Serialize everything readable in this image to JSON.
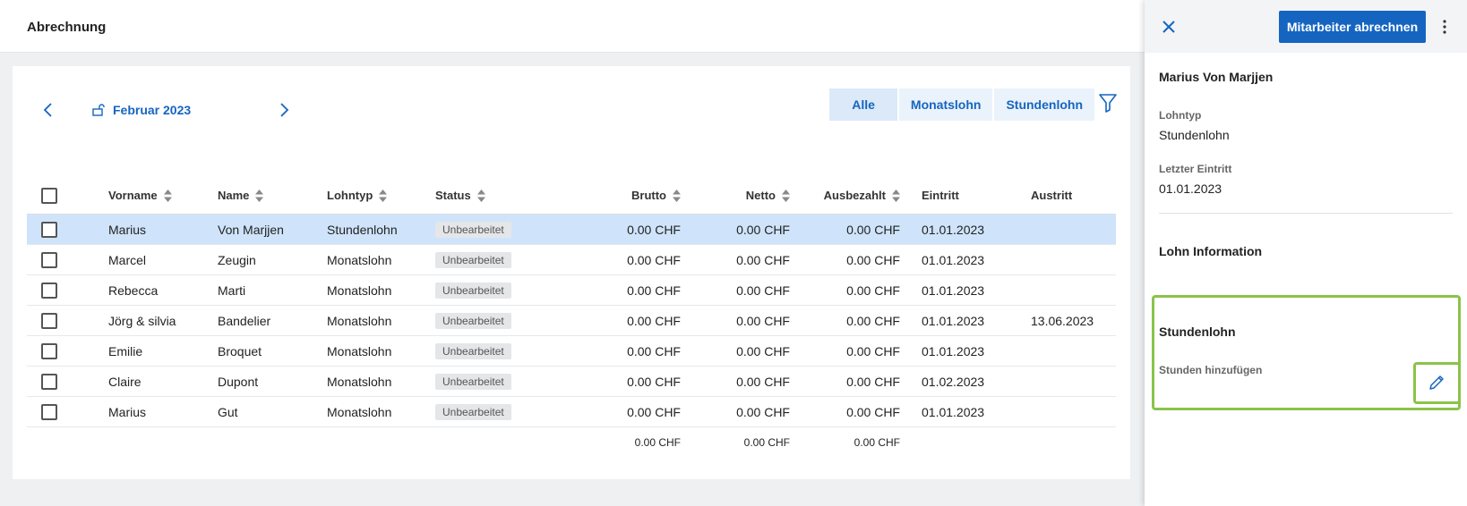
{
  "page": {
    "title": "Abrechnung"
  },
  "month_nav": {
    "label": "Februar 2023"
  },
  "filters": [
    "Alle",
    "Monatslohn",
    "Stundenlohn"
  ],
  "table": {
    "headers": {
      "first": "Vorname",
      "name": "Name",
      "type": "Lohntyp",
      "status": "Status",
      "brutto": "Brutto",
      "netto": "Netto",
      "paid": "Ausbezahlt",
      "entry": "Eintritt",
      "exit": "Austritt"
    },
    "rows": [
      {
        "first": "Marius",
        "name": "Von Marjjen",
        "type": "Stundenlohn",
        "status": "Unbearbeitet",
        "brutto": "0.00 CHF",
        "netto": "0.00 CHF",
        "paid": "0.00 CHF",
        "entry": "01.01.2023",
        "exit": ""
      },
      {
        "first": "Marcel",
        "name": "Zeugin",
        "type": "Monatslohn",
        "status": "Unbearbeitet",
        "brutto": "0.00 CHF",
        "netto": "0.00 CHF",
        "paid": "0.00 CHF",
        "entry": "01.01.2023",
        "exit": ""
      },
      {
        "first": "Rebecca",
        "name": "Marti",
        "type": "Monatslohn",
        "status": "Unbearbeitet",
        "brutto": "0.00 CHF",
        "netto": "0.00 CHF",
        "paid": "0.00 CHF",
        "entry": "01.01.2023",
        "exit": ""
      },
      {
        "first": "Jörg & silvia",
        "name": "Bandelier",
        "type": "Monatslohn",
        "status": "Unbearbeitet",
        "brutto": "0.00 CHF",
        "netto": "0.00 CHF",
        "paid": "0.00 CHF",
        "entry": "01.01.2023",
        "exit": "13.06.2023"
      },
      {
        "first": "Emilie",
        "name": "Broquet",
        "type": "Monatslohn",
        "status": "Unbearbeitet",
        "brutto": "0.00 CHF",
        "netto": "0.00 CHF",
        "paid": "0.00 CHF",
        "entry": "01.01.2023",
        "exit": ""
      },
      {
        "first": "Claire",
        "name": "Dupont",
        "type": "Monatslohn",
        "status": "Unbearbeitet",
        "brutto": "0.00 CHF",
        "netto": "0.00 CHF",
        "paid": "0.00 CHF",
        "entry": "01.02.2023",
        "exit": ""
      },
      {
        "first": "Marius",
        "name": "Gut",
        "type": "Monatslohn",
        "status": "Unbearbeitet",
        "brutto": "0.00 CHF",
        "netto": "0.00 CHF",
        "paid": "0.00 CHF",
        "entry": "01.01.2023",
        "exit": ""
      }
    ],
    "totals": {
      "brutto": "0.00 CHF",
      "netto": "0.00 CHF",
      "paid": "0.00 CHF"
    }
  },
  "panel": {
    "action_label": "Mitarbeiter abrechnen",
    "employee_name": "Marius Von Marjjen",
    "wage_type_label": "Lohntyp",
    "wage_type_value": "Stundenlohn",
    "last_entry_label": "Letzter Eintritt",
    "last_entry_value": "01.01.2023",
    "wage_info_heading": "Lohn Information",
    "hourly_heading": "Stundenlohn",
    "add_hours_label": "Stunden hinzufügen"
  },
  "colors": {
    "accent": "#1565c0",
    "selected_row": "#cfe4fb",
    "highlight": "#8bc34a"
  }
}
